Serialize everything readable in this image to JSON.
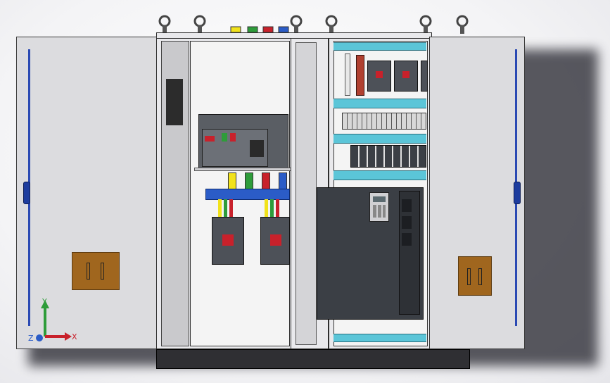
{
  "scene": {
    "description_labels": {},
    "colors": {
      "door": "#dcdcdf",
      "cabinet_frame": "#e9e9ec",
      "din_rail": "#5bc5d8",
      "busbar": "#2b5cc7",
      "handle": "#a0661e",
      "plinth": "#2f2f33",
      "vfd_body": "#3b3f45"
    },
    "cable_colors": [
      "#f1e21b",
      "#2e9c3a",
      "#c8212b",
      "#2b5cc7"
    ],
    "terminal_colors": [
      "#f1e21b",
      "#2e9c3a",
      "#c8212b",
      "#2b5cc7"
    ]
  },
  "axes_triad": {
    "x_label": "X",
    "y_label": "Y",
    "z_label": "Z"
  }
}
